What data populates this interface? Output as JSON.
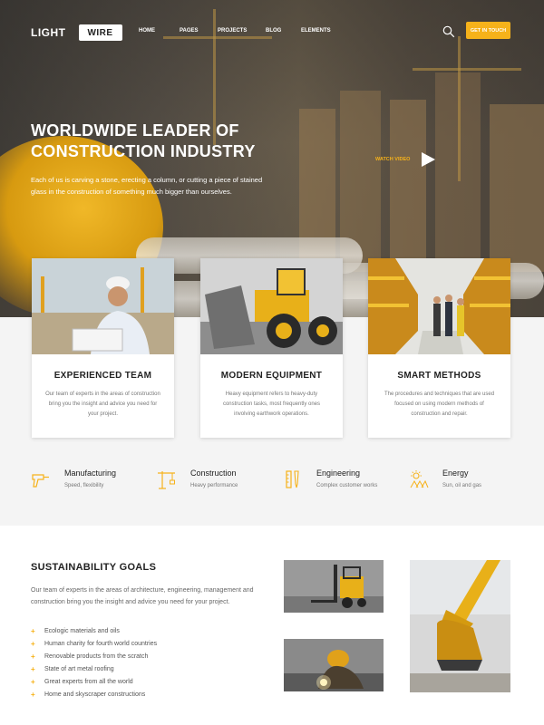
{
  "brand": {
    "part1": "LIGHT",
    "part2": "WIRE"
  },
  "nav": {
    "items": [
      "HOME",
      "PAGES",
      "PROJECTS",
      "BLOG",
      "ELEMENTS"
    ],
    "cta": "GET IN TOUCH"
  },
  "colors": {
    "accent": "#f6b21a",
    "band": "#f4f4f4"
  },
  "hero": {
    "title_line1": "WORLDWIDE LEADER OF",
    "title_line2": "CONSTRUCTION INDUSTRY",
    "text": "Each of us is carving a stone, erecting a column, or cutting a piece of stained glass in the construction of something much bigger than ourselves.",
    "watch_label": "WATCH VIDEO"
  },
  "cards": [
    {
      "title": "EXPERIENCED TEAM",
      "text": "Our team of experts in the areas of construction bring you the insight and advice you need for your project."
    },
    {
      "title": "MODERN EQUIPMENT",
      "text": "Heavy equipment refers to heavy-duty construction tasks, most frequently ones involving earthwork operations."
    },
    {
      "title": "SMART METHODS",
      "text": "The procedures and techniques that are used focused on using modern methods of construction and repair."
    }
  ],
  "services": [
    {
      "title": "Manufacturing",
      "sub": "Speed, flexibility",
      "icon": "drill-icon"
    },
    {
      "title": "Construction",
      "sub": "Heavy performance",
      "icon": "crane-icon"
    },
    {
      "title": "Engineering",
      "sub": "Complex customer works",
      "icon": "tools-icon"
    },
    {
      "title": "Energy",
      "sub": "Sun, oil and gas",
      "icon": "sun-icon"
    }
  ],
  "sustainability": {
    "title": "SUSTAINABILITY GOALS",
    "text": "Our team of experts in the areas of architecture, engineering, management and construction bring you the insight and advice you need for your project.",
    "items": [
      "Ecologic materials and oils",
      "Human charity for fourth world countries",
      "Renovable products from the scratch",
      "State of art metal roofing",
      "Great experts from all the world",
      "Home and skyscraper constructions"
    ]
  }
}
